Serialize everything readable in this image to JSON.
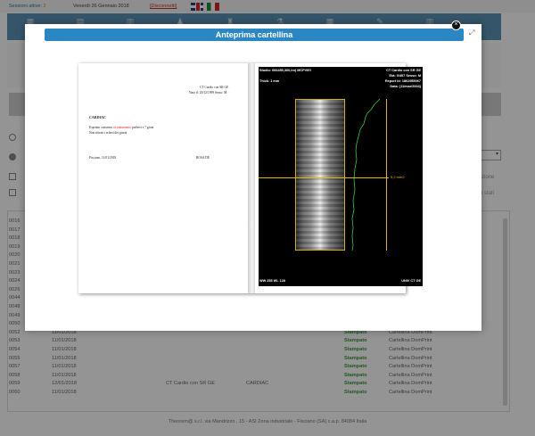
{
  "topbar": {
    "sessions_label": "Sessioni attive:",
    "sessions_count": "2",
    "date": "Venerdì 26 Gennaio 2018",
    "logout": "[Disconnetti]"
  },
  "nav": {
    "items": [
      "▦",
      "▤",
      "▥",
      "♟",
      "♜",
      "⚗",
      "▦",
      "✎",
      "▥"
    ]
  },
  "filters": {
    "side_text_1": "zione",
    "side_text_2": "i stati"
  },
  "table": {
    "rows": [
      {
        "id": "0016",
        "date": "",
        "desc": "",
        "type": "",
        "status": "",
        "print": ""
      },
      {
        "id": "0017",
        "date": "",
        "desc": "",
        "type": "",
        "status": "",
        "print": ""
      },
      {
        "id": "0018",
        "date": "",
        "desc": "",
        "type": "",
        "status": "",
        "print": ""
      },
      {
        "id": "0019",
        "date": "",
        "desc": "",
        "type": "",
        "status": "",
        "print": ""
      },
      {
        "id": "0020",
        "date": "",
        "desc": "",
        "type": "",
        "status": "",
        "print": ""
      },
      {
        "id": "0021",
        "date": "",
        "desc": "",
        "type": "",
        "status": "",
        "print": ""
      },
      {
        "id": "0023",
        "date": "",
        "desc": "",
        "type": "",
        "status": "",
        "print": ""
      },
      {
        "id": "0024",
        "date": "",
        "desc": "",
        "type": "",
        "status": "",
        "print": ""
      },
      {
        "id": "0026",
        "date": "",
        "desc": "",
        "type": "",
        "status": "",
        "print": ""
      },
      {
        "id": "0044",
        "date": "",
        "desc": "",
        "type": "",
        "status": "",
        "print": ""
      },
      {
        "id": "0048",
        "date": "",
        "desc": "",
        "type": "",
        "status": "",
        "print": ""
      },
      {
        "id": "0049",
        "date": "",
        "desc": "",
        "type": "",
        "status": "",
        "print": ""
      },
      {
        "id": "0050",
        "date": "",
        "desc": "",
        "type": "",
        "status": "",
        "print": ""
      },
      {
        "id": "0052",
        "date": "11/01/2018",
        "desc": "",
        "type": "",
        "status": "Stampato",
        "print": "Cartellina DomPrint"
      },
      {
        "id": "0053",
        "date": "11/01/2018",
        "desc": "",
        "type": "",
        "status": "Stampato",
        "print": "Cartellina DomPrint"
      },
      {
        "id": "0054",
        "date": "11/01/2018",
        "desc": "",
        "type": "",
        "status": "Stampato",
        "print": "Cartellina DomPrint"
      },
      {
        "id": "0055",
        "date": "11/01/2018",
        "desc": "",
        "type": "",
        "status": "Stampato",
        "print": "Cartellina DomPrint"
      },
      {
        "id": "0057",
        "date": "11/01/2018",
        "desc": "",
        "type": "",
        "status": "Stampato",
        "print": "Cartellina DomPrint"
      },
      {
        "id": "0058",
        "date": "11/01/2018",
        "desc": "",
        "type": "",
        "status": "Stampato",
        "print": "Cartellina DomPrint"
      },
      {
        "id": "0059",
        "date": "12/01/2018",
        "desc": "CT Cardio con SR GE",
        "type": "CARDIAC",
        "status": "Stampato",
        "print": "Cartellina DomPrint"
      },
      {
        "id": "0060",
        "date": "11/01/2018",
        "desc": "",
        "type": "",
        "status": "Stampato",
        "print": "Cartellina DomPrint"
      }
    ]
  },
  "footer": "Theorem@ s.r.l. via Mandrizzo , 15 - ASI Zona industriale - Fisciano (SA) c.a.p. 84084 Italia",
  "modal": {
    "title": "Anteprima cartellina",
    "close_icon": "×",
    "expand_icon": "⤢"
  },
  "preview": {
    "left_page": {
      "header_1": "CT Cardio con SR GE",
      "header_2": "Nato il: 20/12/1999   Sesso: M",
      "section": "CARDIAC",
      "line_1a": "Esprimo consenso ",
      "line_1b": "al trattamento",
      "line_1c": " prelievi e 7 gioni",
      "line_2": "Non ritirati i referti dei giorni",
      "place_date": "Fisciano, 11/01/2018",
      "signature": "ROSA DE"
    },
    "right_page": {
      "study": "Studio: 666455,300,hn)    MCPVIEI",
      "series": "CT Cardio con SR GE",
      "age_sex": "Età: 0/407    Sesso: M",
      "report": "Report id: 1862955067",
      "date_line": "Data: (11/mar/2004)",
      "thick": "Thick: 1 mm",
      "measure": "5,2 mm2",
      "ww": "WW 255 WL 128",
      "unit": "UNIV CT GE"
    }
  }
}
